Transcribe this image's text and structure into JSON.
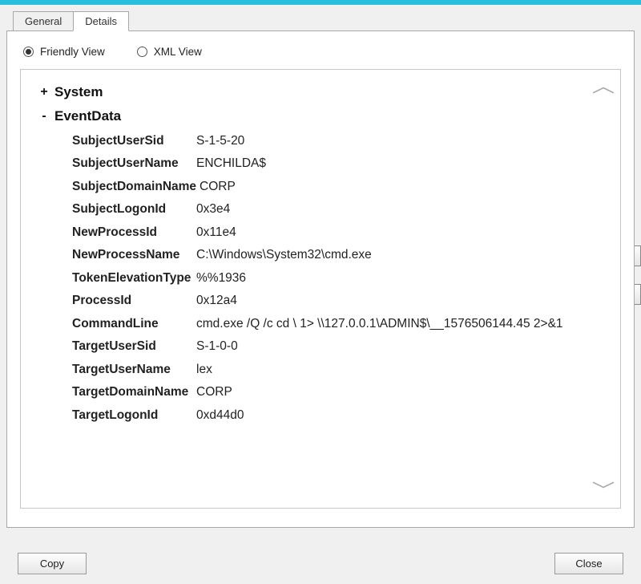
{
  "tabs": {
    "general": "General",
    "details": "Details"
  },
  "view": {
    "friendly": "Friendly View",
    "xml": "XML View"
  },
  "tree": {
    "system": {
      "toggle": "+",
      "label": "System"
    },
    "eventdata": {
      "toggle": "-",
      "label": "EventData"
    }
  },
  "fields": [
    {
      "name": "SubjectUserSid",
      "value": "S-1-5-20"
    },
    {
      "name": "SubjectUserName",
      "value": "ENCHILDA$"
    },
    {
      "name": "SubjectDomainName",
      "value": "CORP"
    },
    {
      "name": "SubjectLogonId",
      "value": "0x3e4"
    },
    {
      "name": "NewProcessId",
      "value": "0x11e4"
    },
    {
      "name": "NewProcessName",
      "value": "C:\\Windows\\System32\\cmd.exe"
    },
    {
      "name": "TokenElevationType",
      "value": "%%1936"
    },
    {
      "name": "ProcessId",
      "value": "0x12a4"
    },
    {
      "name": "CommandLine",
      "value": "cmd.exe /Q /c cd \\ 1> \\\\127.0.0.1\\ADMIN$\\__1576506144.45 2>&1"
    },
    {
      "name": "TargetUserSid",
      "value": "S-1-0-0"
    },
    {
      "name": "TargetUserName",
      "value": "lex"
    },
    {
      "name": "TargetDomainName",
      "value": "CORP"
    },
    {
      "name": "TargetLogonId",
      "value": "0xd44d0"
    }
  ],
  "buttons": {
    "copy": "Copy",
    "close": "Close"
  },
  "side": {
    "up": "⬆",
    "down": "⬇"
  },
  "scroll_glyph_up": "︿",
  "scroll_glyph_down": "﹀"
}
